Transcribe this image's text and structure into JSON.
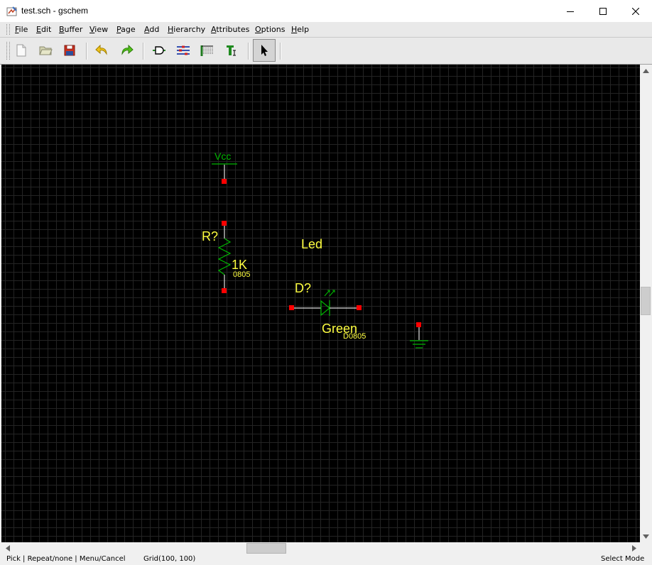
{
  "window": {
    "title": "test.sch - gschem",
    "icons": {
      "app": "gschem-icon",
      "minimize": "minimize-icon",
      "maximize": "maximize-icon",
      "close": "close-icon"
    }
  },
  "menubar": {
    "items": [
      {
        "mnemonic": "F",
        "rest": "ile"
      },
      {
        "mnemonic": "E",
        "rest": "dit"
      },
      {
        "mnemonic": "B",
        "rest": "uffer"
      },
      {
        "mnemonic": "V",
        "rest": "iew"
      },
      {
        "mnemonic": "P",
        "rest": "age"
      },
      {
        "mnemonic": "A",
        "rest": "dd"
      },
      {
        "mnemonic": "H",
        "rest": "ierarchy"
      },
      {
        "mnemonic": "A",
        "rest": "ttributes"
      },
      {
        "mnemonic": "O",
        "rest": "ptions"
      },
      {
        "mnemonic": "H",
        "rest": "elp"
      }
    ]
  },
  "toolbar": {
    "buttons": [
      "new-file-icon",
      "open-folder-icon",
      "save-icon",
      "undo-icon",
      "redo-icon",
      "add-component-icon",
      "add-net-icon",
      "add-bus-icon",
      "add-text-icon",
      "select-pointer-icon"
    ],
    "active": "select-pointer-icon"
  },
  "colors": {
    "canvas_bg": "#000000",
    "grid": "#242424",
    "component_line": "#00b800",
    "net_line": "#e0e0e0",
    "attribute_text": "#ffff40",
    "pin_end": "#ff0000"
  },
  "schematic": {
    "labels": {
      "vcc": "Vcc",
      "refdes_r": "R?",
      "value_r": "1K",
      "footprint_r": "0805",
      "device_led": "Led",
      "refdes_d": "D?",
      "value_d": "Green",
      "footprint_d": "D0805"
    }
  },
  "statusbar": {
    "mouse": "Pick | Repeat/none | Menu/Cancel",
    "grid": "Grid(100, 100)",
    "mode": "Select Mode"
  }
}
